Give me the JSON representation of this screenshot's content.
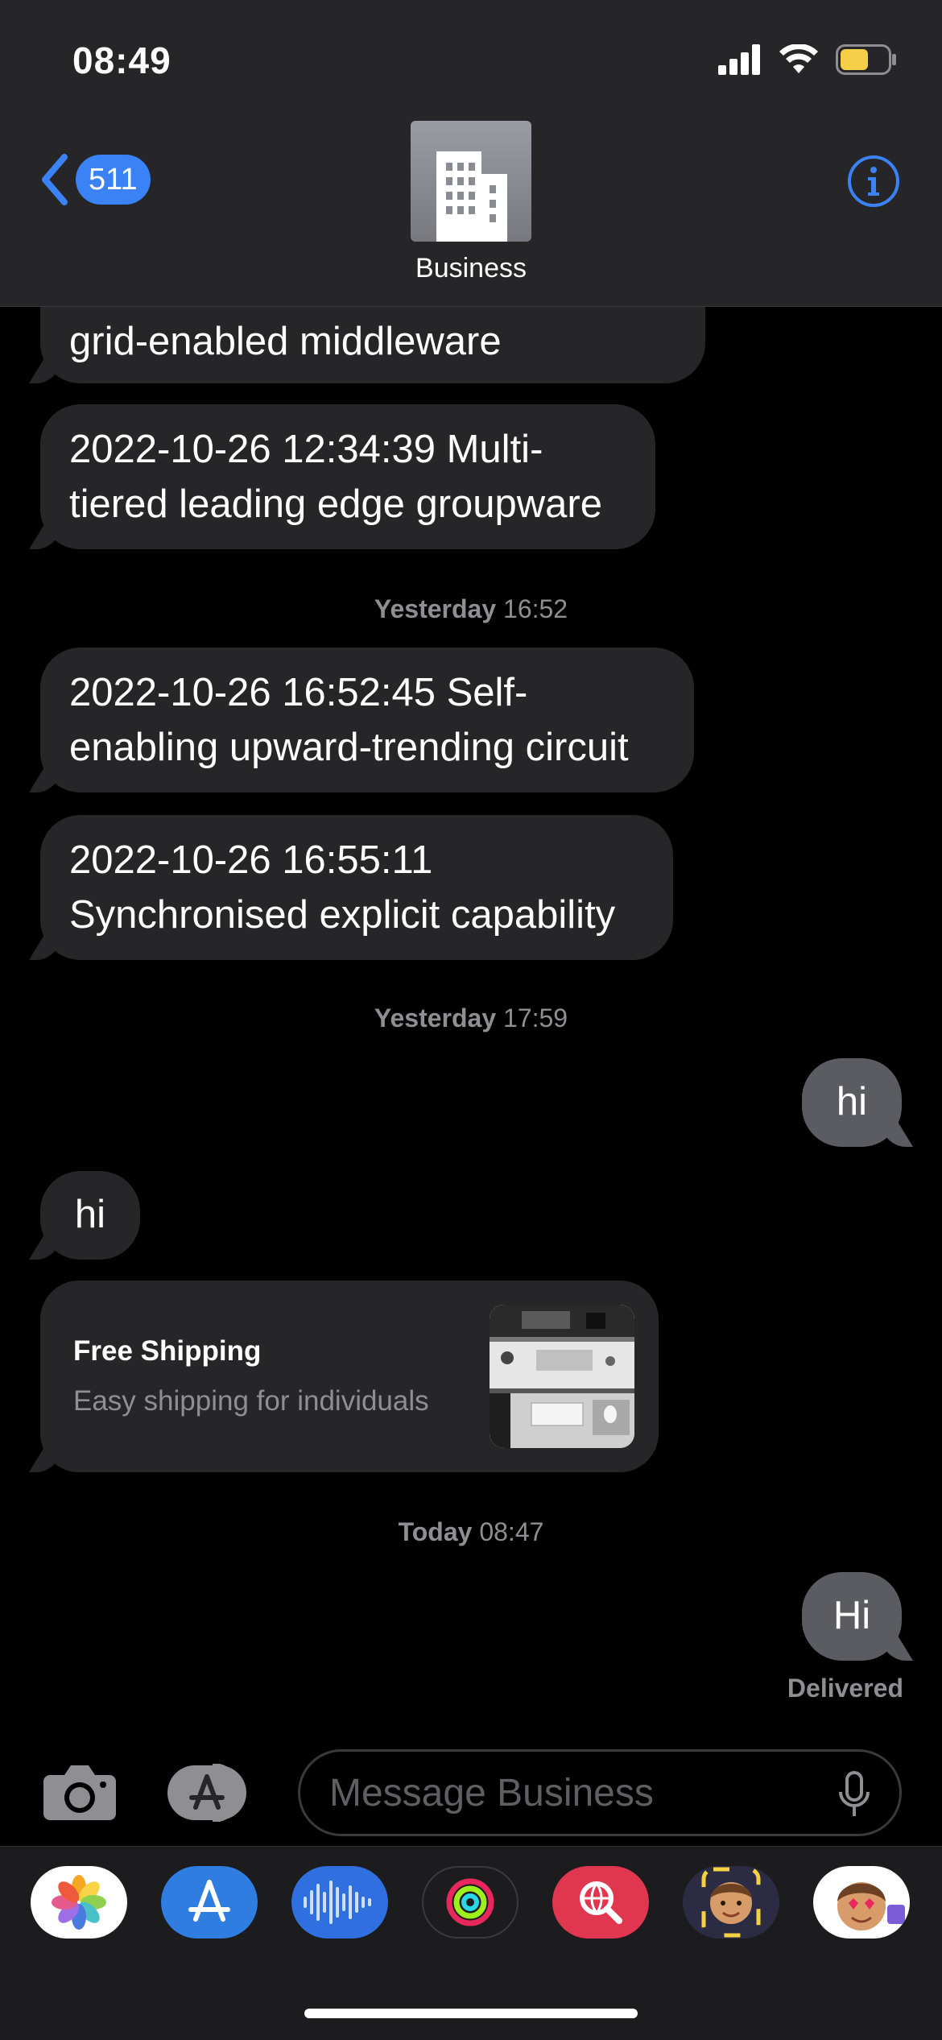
{
  "status_bar": {
    "time": "08:49"
  },
  "header": {
    "back_count": "511",
    "contact_name": "Business"
  },
  "messages": {
    "m1": "grid-enabled middleware",
    "m2_line1": "2022-10-26 12:34:39 Multi-",
    "m2_line2": "tiered leading edge groupware",
    "stamp1_day": "Yesterday",
    "stamp1_time": "16:52",
    "m3_line1": "2022-10-26 16:52:45 Self-",
    "m3_line2": "enabling upward-trending circuit",
    "m4_line1": "2022-10-26 16:55:11",
    "m4_line2": "Synchronised explicit capability",
    "stamp2_day": "Yesterday",
    "stamp2_time": "17:59",
    "out1": "hi",
    "in_hi": "hi",
    "card_title": "Free Shipping",
    "card_subtitle": "Easy shipping for individuals",
    "stamp3_day": "Today",
    "stamp3_time": "08:47",
    "out2": "Hi",
    "delivered": "Delivered"
  },
  "input": {
    "placeholder": "Message Business"
  },
  "app_drawer": {
    "apps": [
      "photos-app-icon",
      "appstore-app-icon",
      "audio-message-icon",
      "activity-app-icon",
      "web-search-icon",
      "memoji-icon",
      "memoji-stickers-icon"
    ]
  },
  "colors": {
    "accent": "#3b82f6",
    "incoming_bubble": "#262628",
    "outgoing_bubble": "#5a5c62",
    "timestamp": "#8e8e93"
  }
}
